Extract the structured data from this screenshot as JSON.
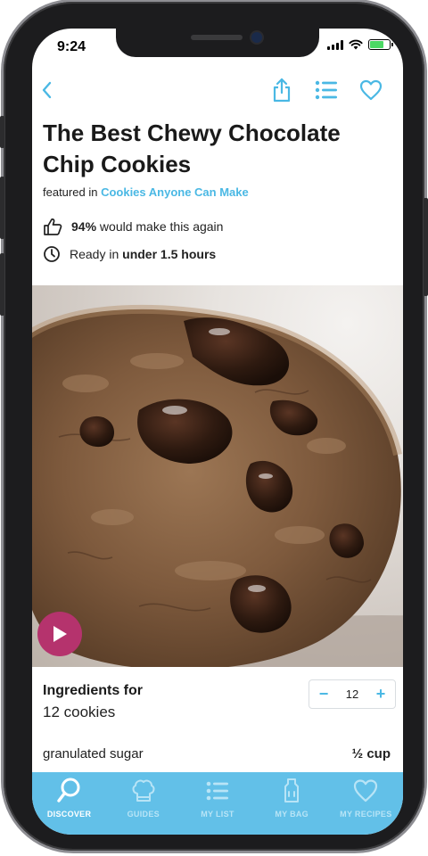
{
  "status_bar": {
    "time": "9:24"
  },
  "toolbar": {
    "back_icon": "chevron-left-icon",
    "share_icon": "share-icon",
    "list_icon": "list-icon",
    "favorite_icon": "heart-icon"
  },
  "recipe": {
    "title": "The Best Chewy Chocolate Chip Cookies",
    "featured_prefix": "featured in",
    "featured_link": "Cookies Anyone Can Make",
    "rating_value": "94%",
    "rating_text": "would make this again",
    "time_prefix": "Ready in",
    "time_value": "under 1.5 hours"
  },
  "ingredients": {
    "heading": "Ingredients for",
    "yield": "12 cookies",
    "servings": "12",
    "minus": "−",
    "plus": "+",
    "items": [
      {
        "name": "granulated sugar",
        "quantity": "½ cup"
      }
    ]
  },
  "tab_bar": {
    "active": "discover",
    "tabs": [
      {
        "label": "DISCOVER",
        "icon": "search-icon"
      },
      {
        "label": "GUIDES",
        "icon": "chef-hat-icon"
      },
      {
        "label": "MY LIST",
        "icon": "list-icon"
      },
      {
        "label": "MY BAG",
        "icon": "bag-icon"
      },
      {
        "label": "MY RECIPES",
        "icon": "heart-icon"
      }
    ]
  },
  "colors": {
    "accent": "#4ab8e4",
    "tab_bar": "#62c0e8",
    "play_button": "#b5336d"
  }
}
